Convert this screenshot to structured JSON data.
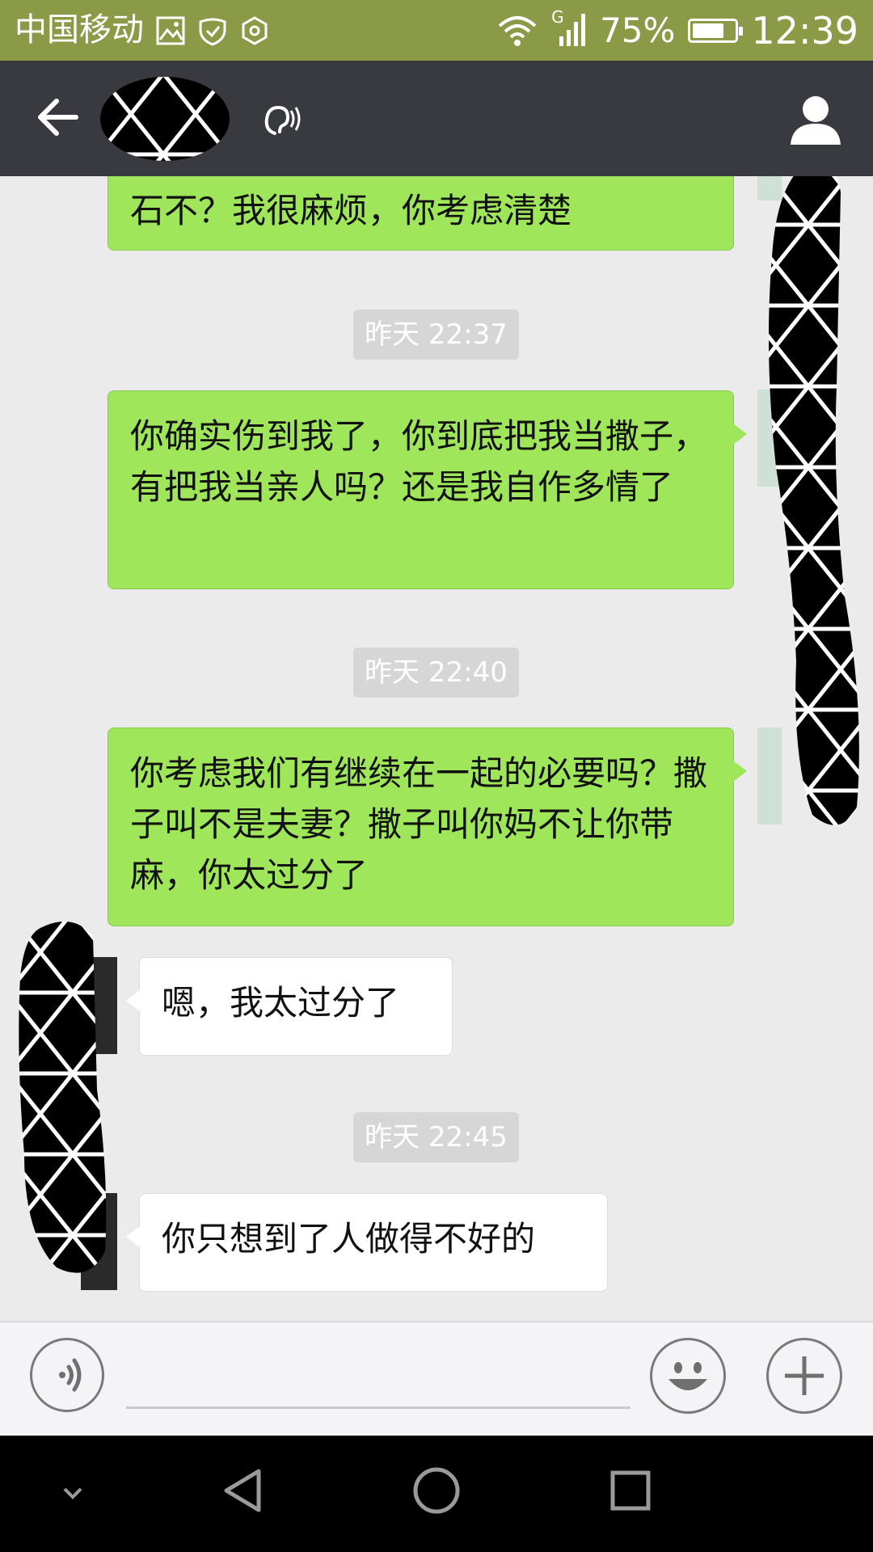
{
  "status_bar": {
    "carrier": "中国移动",
    "network_type": "G",
    "battery_percent_text": "75%",
    "battery_level": 0.75,
    "time": "12:39",
    "icons": [
      "gallery-icon",
      "wechat-security-icon",
      "hexagon-icon",
      "wifi-icon",
      "signal-icon",
      "battery-icon"
    ]
  },
  "title_bar": {
    "icons": [
      "back-arrow-icon",
      "earpiece-mode-icon",
      "profile-icon"
    ]
  },
  "messages": [
    {
      "side": "sent",
      "text": "石不？我很麻烦，你考虑清楚"
    },
    {
      "timestamp": "昨天 22:37"
    },
    {
      "side": "sent",
      "text": "你确实伤到我了，你到底把我当撒子，有把我当亲人吗？还是我自作多情了"
    },
    {
      "timestamp": "昨天 22:40"
    },
    {
      "side": "sent",
      "text": "你考虑我们有继续在一起的必要吗？撒子叫不是夫妻？撒子叫你妈不让你带麻，你太过分了"
    },
    {
      "side": "received",
      "text": "嗯，我太过分了"
    },
    {
      "timestamp": "昨天 22:45"
    },
    {
      "side": "received",
      "text": "你只想到了人做得不好的"
    }
  ],
  "input_bar": {
    "text_value": "",
    "icons": [
      "voice-icon",
      "emoji-icon",
      "plus-icon"
    ]
  },
  "nav_bar": {
    "icons": [
      "collapse-icon",
      "back-triangle-icon",
      "home-circle-icon",
      "recents-square-icon"
    ]
  },
  "colors": {
    "status_bar": "#8a9a47",
    "title_bar": "#393a3f",
    "chat_background": "#ebebeb",
    "sent_bubble": "#9fe65a",
    "received_bubble": "#ffffff",
    "timestamp_pill": "#d6d6d6"
  }
}
